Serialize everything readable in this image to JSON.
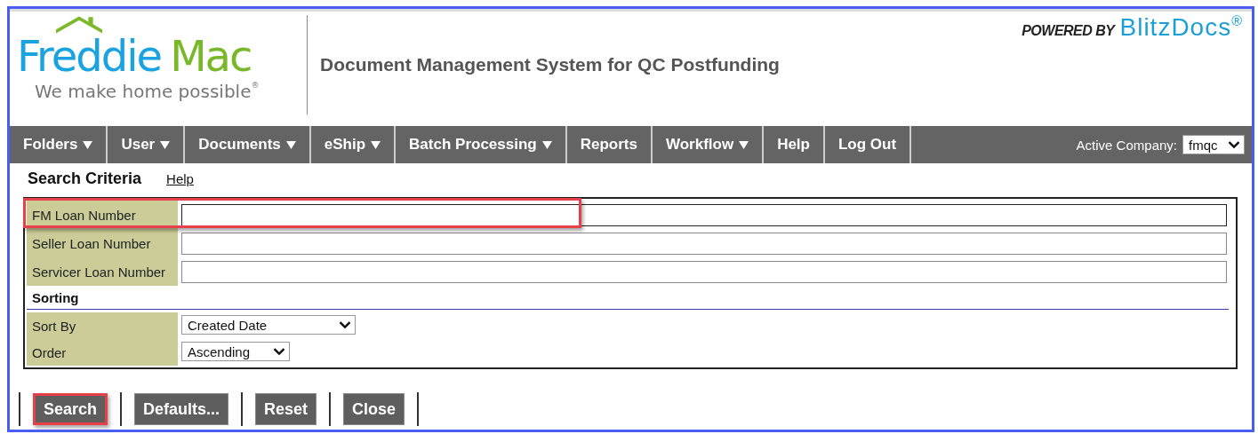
{
  "header": {
    "logo": {
      "word_1": "Freddie",
      "word_2": "Mac",
      "tagline": "We make home possible",
      "tagline_mark": "®"
    },
    "app_title": "Document Management System for QC Postfunding",
    "powered_by": "POWERED BY",
    "brand": "BlitzDocs",
    "brand_mark": "®"
  },
  "menu": [
    {
      "label": "Folders",
      "has_dropdown": true
    },
    {
      "label": "User",
      "has_dropdown": true
    },
    {
      "label": "Documents",
      "has_dropdown": true
    },
    {
      "label": "eShip",
      "has_dropdown": true
    },
    {
      "label": "Batch Processing",
      "has_dropdown": true
    },
    {
      "label": "Reports",
      "has_dropdown": false
    },
    {
      "label": "Workflow",
      "has_dropdown": true
    },
    {
      "label": "Help",
      "has_dropdown": false
    },
    {
      "label": "Log Out",
      "has_dropdown": false
    }
  ],
  "active_company": {
    "label": "Active Company:",
    "value": "fmqc"
  },
  "search_criteria": {
    "title": "Search Criteria",
    "help_link": "Help",
    "fields": [
      {
        "label": "FM Loan Number",
        "highlighted": true
      },
      {
        "label": "Seller Loan Number",
        "highlighted": false
      },
      {
        "label": "Servicer Loan Number",
        "highlighted": false
      }
    ],
    "sorting_title": "Sorting",
    "sort_fields": [
      {
        "label": "Sort By",
        "value": "Created Date"
      },
      {
        "label": "Order",
        "value": "Ascending"
      }
    ]
  },
  "buttons": [
    {
      "label": "Search",
      "highlighted": true
    },
    {
      "label": "Defaults...",
      "highlighted": false
    },
    {
      "label": "Reset",
      "highlighted": false
    },
    {
      "label": "Close",
      "highlighted": false
    }
  ]
}
